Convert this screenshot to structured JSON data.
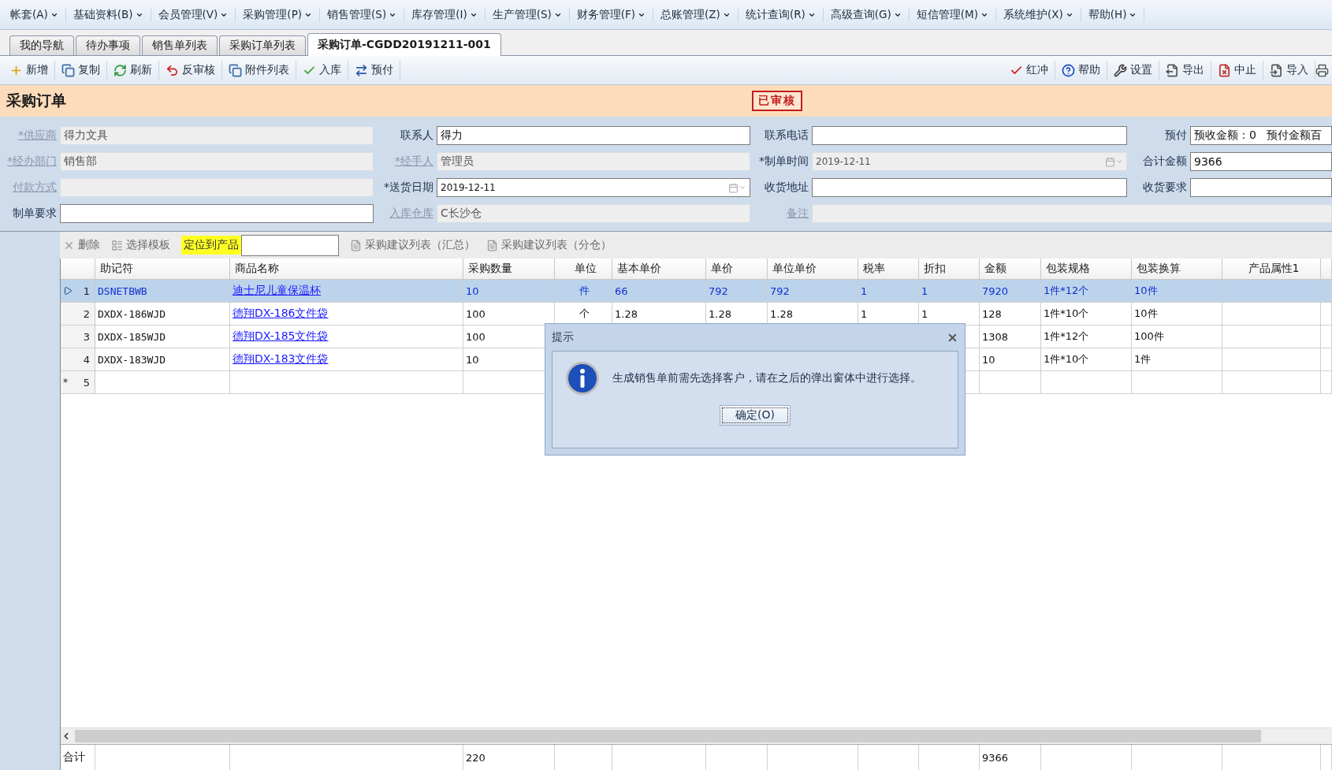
{
  "menu": [
    "帐套(A)",
    "基础资料(B)",
    "会员管理(V)",
    "采购管理(P)",
    "销售管理(S)",
    "库存管理(I)",
    "生产管理(S)",
    "财务管理(F)",
    "总账管理(Z)",
    "统计查询(R)",
    "高级查询(G)",
    "短信管理(M)",
    "系统维护(X)",
    "帮助(H)"
  ],
  "tabs": [
    {
      "label": "我的导航",
      "selected": false
    },
    {
      "label": "待办事项",
      "selected": false
    },
    {
      "label": "销售单列表",
      "selected": false
    },
    {
      "label": "采购订单列表",
      "selected": false
    },
    {
      "label": "采购订单-CGDD20191211-001",
      "selected": true
    }
  ],
  "toolbar_left": [
    {
      "label": "新增",
      "kind": "add"
    },
    {
      "label": "复制",
      "kind": "copy"
    },
    {
      "label": "刷新",
      "kind": "refresh"
    },
    {
      "label": "反审核",
      "kind": "undo"
    },
    {
      "label": "附件列表",
      "kind": "copy"
    },
    {
      "label": "入库",
      "kind": "check"
    },
    {
      "label": "预付",
      "kind": "pay"
    }
  ],
  "toolbar_right": [
    {
      "label": "红冲",
      "kind": "redcheck"
    },
    {
      "label": "帮助",
      "kind": "help"
    },
    {
      "label": "设置",
      "kind": "tools"
    },
    {
      "label": "导出",
      "kind": "export"
    },
    {
      "label": "中止",
      "kind": "stop"
    },
    {
      "label": "导入",
      "kind": "import"
    }
  ],
  "page_title": "采购订单",
  "status_stamp": "已审核",
  "form": [
    [
      {
        "label": "*供应商",
        "link": true,
        "value": "得力文具",
        "disabled": true
      },
      {
        "label": "联系人",
        "link": false,
        "value": "得力",
        "disabled": false
      },
      {
        "label": "联系电话",
        "link": false,
        "disabled": false
      },
      {
        "label": "预付",
        "link": false,
        "value": "预收金额：0   预付金额百",
        "disabled": false
      }
    ],
    [
      {
        "label": "*经办部门",
        "link": true,
        "value": "销售部",
        "disabled": true
      },
      {
        "label": "*经手人",
        "link": true,
        "value": "管理员",
        "disabled": true
      },
      {
        "label": "*制单时间",
        "link": false,
        "value": "2019-12-11",
        "disabled": true,
        "kind": "date"
      },
      {
        "label": "合计金额",
        "link": false,
        "value": "9366",
        "disabled": false
      }
    ],
    [
      {
        "label": "付款方式",
        "link": true,
        "disabled": true
      },
      {
        "label": "*送货日期",
        "link": false,
        "value": "2019-12-11",
        "disabled": false,
        "kind": "date"
      },
      {
        "label": "收货地址",
        "link": false,
        "disabled": false
      },
      {
        "label": "收货要求",
        "link": false,
        "disabled": false
      }
    ],
    [
      {
        "label": "制单要求",
        "link": false,
        "disabled": false
      },
      {
        "label": "入库仓库",
        "link": true,
        "value": "C长沙仓",
        "disabled": true
      },
      {
        "label": "备注",
        "link": true,
        "disabled": true
      }
    ]
  ],
  "grid_toolbar": {
    "delete": "删除",
    "template": "选择模板",
    "locate": "定位到产品",
    "suggest_total": "采购建议列表（汇总）",
    "suggest_warehouse": "采购建议列表（分仓）"
  },
  "table": {
    "columns": [
      "助记符",
      "商品名称",
      "采购数量",
      "单位",
      "基本单价",
      "单价",
      "单位单价",
      "税率",
      "折扣",
      "金额",
      "包装规格",
      "包装换算",
      "产品属性1"
    ],
    "rows": [
      {
        "index": "1",
        "selected": true,
        "cells": [
          "DSNETBWB",
          "迪士尼儿童保温杯",
          "10",
          "件",
          "66",
          "792",
          "792",
          "1",
          "1"
        ],
        "right_cells": [
          "7920",
          "1件*12个",
          "10件"
        ]
      },
      {
        "index": "2",
        "selected": false,
        "cells": [
          "DXDX-186WJD",
          "德翔DX-186文件袋",
          "100",
          "个",
          "1.28",
          "1.28",
          "1.28",
          "1",
          "1"
        ],
        "right_cells": [
          "128",
          "1件*10个",
          "10件"
        ]
      },
      {
        "index": "3",
        "selected": false,
        "cells": [
          "DXDX-185WJD",
          "德翔DX-185文件袋",
          "100"
        ],
        "right_cells": [
          "1308",
          "1件*12个",
          "100件"
        ]
      },
      {
        "index": "4",
        "selected": false,
        "cells": [
          "DXDX-183WJD",
          "德翔DX-183文件袋",
          "10"
        ],
        "right_cells": [
          "10",
          "1件*10个",
          "1件"
        ]
      },
      {
        "index": "5",
        "selected": false,
        "marker": "*"
      }
    ],
    "totals_label": "合计",
    "total_quantity": "220",
    "total_amount": "9366"
  },
  "dialog": {
    "title": "提示",
    "message": "生成销售单前需先选择客户，请在之后的弹出窗体中进行选择。",
    "button": "确定(O)"
  }
}
